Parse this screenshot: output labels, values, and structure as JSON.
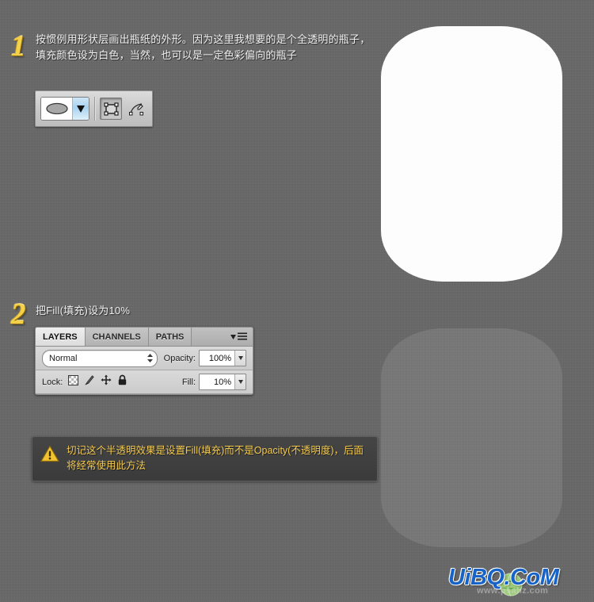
{
  "background": {
    "color": "#676767"
  },
  "steps": [
    {
      "number": "1",
      "text": "按惯例用形状层画出瓶纸的外形。因为这里我想要的是个全透明的瓶子，填充颜色设为白色，当然，也可以是一定色彩偏向的瓶子"
    },
    {
      "number": "2",
      "text": "把Fill(填充)设为10%"
    }
  ],
  "shape_toolbar": {
    "shape_preset": "ellipse-shape",
    "caret": "▼",
    "modes": [
      {
        "name": "shape-layers-mode",
        "state": "pressed"
      },
      {
        "name": "paths-mode",
        "state": "normal"
      }
    ]
  },
  "layers_panel": {
    "tabs": [
      {
        "label": "LAYERS",
        "active": true
      },
      {
        "label": "CHANNELS",
        "active": false
      },
      {
        "label": "PATHS",
        "active": false
      }
    ],
    "menu_icon": "panel-menu-icon",
    "blend_mode": {
      "value": "Normal",
      "stepper": "⇕"
    },
    "opacity": {
      "label": "Opacity:",
      "value": "100%",
      "caret": "▾"
    },
    "lock": {
      "label": "Lock:",
      "icons": [
        "lock-transparent-pixels-icon",
        "lock-image-pixels-icon",
        "lock-position-icon",
        "lock-all-icon"
      ]
    },
    "fill": {
      "label": "Fill:",
      "value": "10%",
      "caret": "▾"
    }
  },
  "warning": {
    "icon": "warning-triangle-icon",
    "text": "切记这个半透明效果是设置Fill(填充)而不是Opacity(不透明度)，后面将经常使用此方法",
    "text_color": "#f3c94e"
  },
  "canvas_shapes": [
    {
      "name": "bottle-shape-white",
      "fill": "#fdfdfd",
      "opacity": "100%"
    },
    {
      "name": "bottle-shape-fill-10",
      "fill": "#ffffff",
      "opacity": "10%"
    }
  ],
  "watermark": {
    "text": "UiBQ.CoM",
    "sub_text": "www.psahz.com",
    "color": "#1763c8",
    "globe": "globe-icon"
  }
}
